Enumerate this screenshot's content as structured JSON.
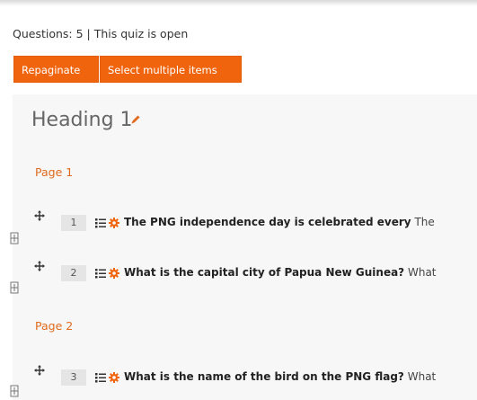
{
  "status_text": "Questions: 5 | This quiz is open",
  "buttons": {
    "repaginate": "Repaginate",
    "select_multiple": "Select multiple items"
  },
  "section": {
    "heading": "Heading 1"
  },
  "pages": [
    {
      "label": "Page 1"
    },
    {
      "label": "Page 2"
    }
  ],
  "questions": [
    {
      "number": "1",
      "title": "The PNG independence day is celebrated every",
      "preview": "The"
    },
    {
      "number": "2",
      "title": "What is the capital city of Papua New Guinea?",
      "preview": "What"
    },
    {
      "number": "3",
      "title": "What is the name of the bird on the PNG flag?",
      "preview": "What"
    }
  ],
  "colors": {
    "accent": "#f0640d",
    "page_label": "#e06a1c"
  },
  "icons": [
    "move-icon",
    "question-type-icon",
    "gear-icon",
    "edit-pencil-icon",
    "page-break-icon"
  ]
}
